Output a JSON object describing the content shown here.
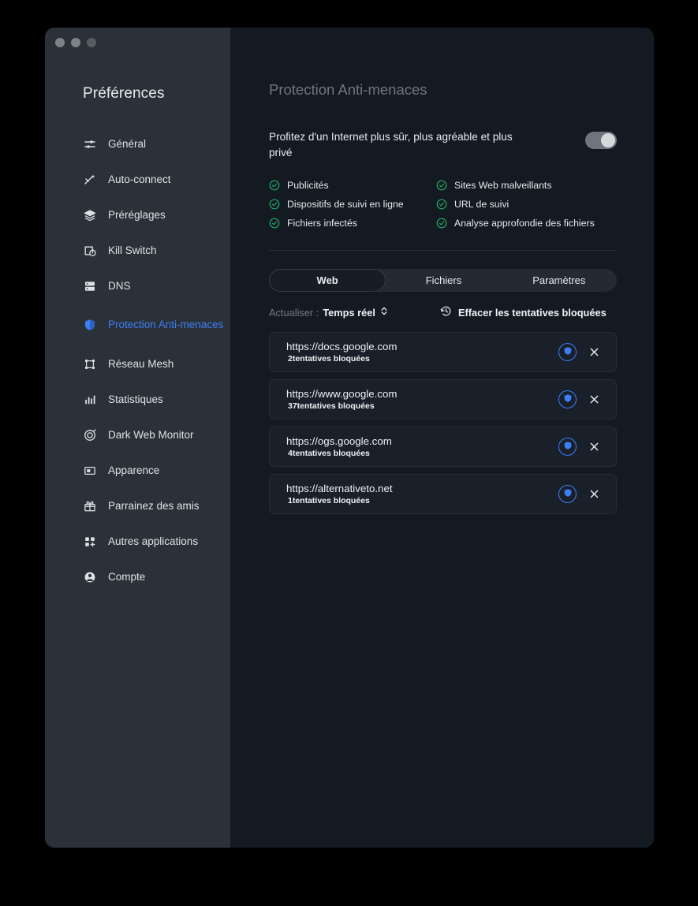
{
  "window": {
    "traffic_lights": [
      "close",
      "minimize",
      "zoom"
    ]
  },
  "sidebar": {
    "title": "Préférences",
    "items": [
      {
        "label": "Général",
        "icon": "sliders-icon",
        "active": false
      },
      {
        "label": "Auto-connect",
        "icon": "magic-wand-icon",
        "active": false
      },
      {
        "label": "Préréglages",
        "icon": "layers-icon",
        "active": false
      },
      {
        "label": "Kill Switch",
        "icon": "power-switch-icon",
        "active": false
      },
      {
        "label": "DNS",
        "icon": "server-icon",
        "active": false
      },
      {
        "label": "Protection Anti-menaces",
        "icon": "shield-icon",
        "active": true
      },
      {
        "label": "Réseau Mesh",
        "icon": "mesh-network-icon",
        "active": false
      },
      {
        "label": "Statistiques",
        "icon": "bar-chart-icon",
        "active": false
      },
      {
        "label": "Dark Web Monitor",
        "icon": "radar-target-icon",
        "active": false
      },
      {
        "label": "Apparence",
        "icon": "window-icon",
        "active": false
      },
      {
        "label": "Parrainez des amis",
        "icon": "gift-icon",
        "active": false
      },
      {
        "label": "Autres applications",
        "icon": "grid-plus-icon",
        "active": false
      },
      {
        "label": "Compte",
        "icon": "person-icon",
        "active": false
      }
    ]
  },
  "main": {
    "page_title": "Protection Anti-menaces",
    "intro_text": "Profitez d'un Internet plus sûr, plus agréable et plus privé",
    "toggle": {
      "state": "on",
      "icon": "toggle-switch-icon"
    },
    "features": [
      {
        "label": "Publicités",
        "icon": "check-circle-icon"
      },
      {
        "label": "Sites Web malveillants",
        "icon": "check-circle-icon"
      },
      {
        "label": "Dispositifs de suivi en ligne",
        "icon": "check-circle-icon"
      },
      {
        "label": "URL de suivi",
        "icon": "check-circle-icon"
      },
      {
        "label": "Fichiers infectés",
        "icon": "check-circle-icon"
      },
      {
        "label": "Analyse approfondie des fichiers",
        "icon": "check-circle-icon"
      }
    ],
    "tabs": [
      {
        "label": "Web",
        "active": true
      },
      {
        "label": "Fichiers",
        "active": false
      },
      {
        "label": "Paramètres",
        "active": false
      }
    ],
    "controls": {
      "refresh_label": "Actualiser :",
      "refresh_value": "Temps réel",
      "refresh_chevron_icon": "chevron-up-down-icon",
      "clear_label": "Effacer les tentatives bloquées",
      "clear_icon": "history-clock-icon"
    },
    "blocked_list": [
      {
        "url": "https://docs.google.com",
        "attempts": "2tentatives bloquées"
      },
      {
        "url": "https://www.google.com",
        "attempts": "37tentatives bloquées"
      },
      {
        "url": "https://ogs.google.com",
        "attempts": "4tentatives bloquées"
      },
      {
        "url": "https://alternativeto.net",
        "attempts": "1tentatives bloquées"
      }
    ]
  },
  "colors": {
    "accent_blue": "#3c7ef5",
    "check_green": "#1fa862",
    "sidebar_bg": "#2b3138",
    "content_bg": "#141a22",
    "row_bg": "#1a202a"
  }
}
